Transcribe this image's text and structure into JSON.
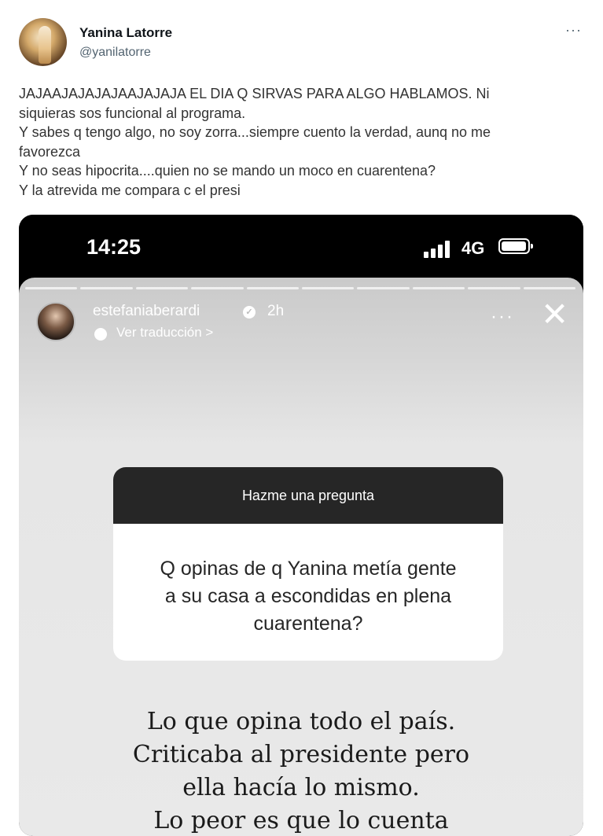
{
  "tweet": {
    "display_name": "Yanina Latorre",
    "handle": "@yanilatorre",
    "more": "···",
    "lines": [
      "JAJAAJAJAJAJAAJAJAJA EL DIA Q SIRVAS PARA ALGO HABLAMOS. Ni",
      "siquieras sos funcional al programa.",
      "Y sabes q tengo algo, no soy zorra...siempre cuento la verdad, aunq no me",
      "favorezca",
      "Y no seas hipocrita....quien no se mando un moco en cuarentena?",
      "Y la atrevida me compara c el presi"
    ]
  },
  "story": {
    "status_time": "14:25",
    "network": "4G",
    "username": "estefaniaberardi",
    "time_ago": "2h",
    "translate_label": "Ver traducción >",
    "more": "···",
    "close": "✕",
    "question_header": "Hazme una pregunta",
    "question_lines": [
      "Q opinas de q Yanina metía gente",
      "a su casa a escondidas en plena",
      "cuarentena?"
    ],
    "answer_lines": [
      "Lo que opina todo el país.",
      "Criticaba al presidente pero",
      "ella hacía lo mismo.",
      "Lo peor es que lo cuenta"
    ]
  }
}
